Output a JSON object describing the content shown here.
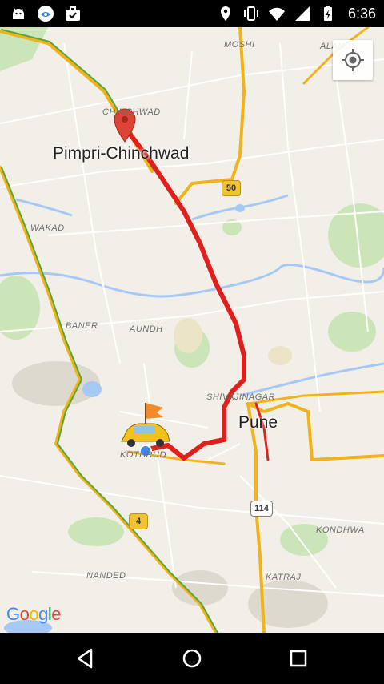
{
  "status_bar": {
    "time": "6:36",
    "left_icons": [
      "android-icon",
      "browser-icon",
      "briefcase-icon"
    ],
    "right_icons": [
      "location-icon",
      "vibrate-icon",
      "wifi-icon",
      "signal-icon",
      "battery-icon"
    ]
  },
  "map": {
    "cities": [
      {
        "name": "Pimpri-Chinchwad"
      },
      {
        "name": "Pune"
      }
    ],
    "areas": {
      "moshi": "MOSHI",
      "alandi": "ALANDI",
      "chinchwad": "CHINCHWAD",
      "wakad": "WAKAD",
      "baner": "BANER",
      "aundh": "AUNDH",
      "shivajinagar": "SHIVAJINAGAR",
      "kothrud": "KOTHRUD",
      "kondhwa": "KONDHWA",
      "nanded": "NANDED",
      "katraj": "KATRAJ"
    },
    "shields": {
      "nh50": "50",
      "nh4": "4",
      "nh114": "114"
    },
    "logo_text": "Google",
    "colors": {
      "route": "#e0201c",
      "traffic_yellow": "#f1b31c",
      "traffic_green": "#5aa53b",
      "pin": "#db4437",
      "water": "#a6c8f5",
      "park": "#c7e2b3"
    }
  },
  "nav_bar": {
    "buttons": [
      "back-icon",
      "home-icon",
      "recents-icon"
    ]
  }
}
